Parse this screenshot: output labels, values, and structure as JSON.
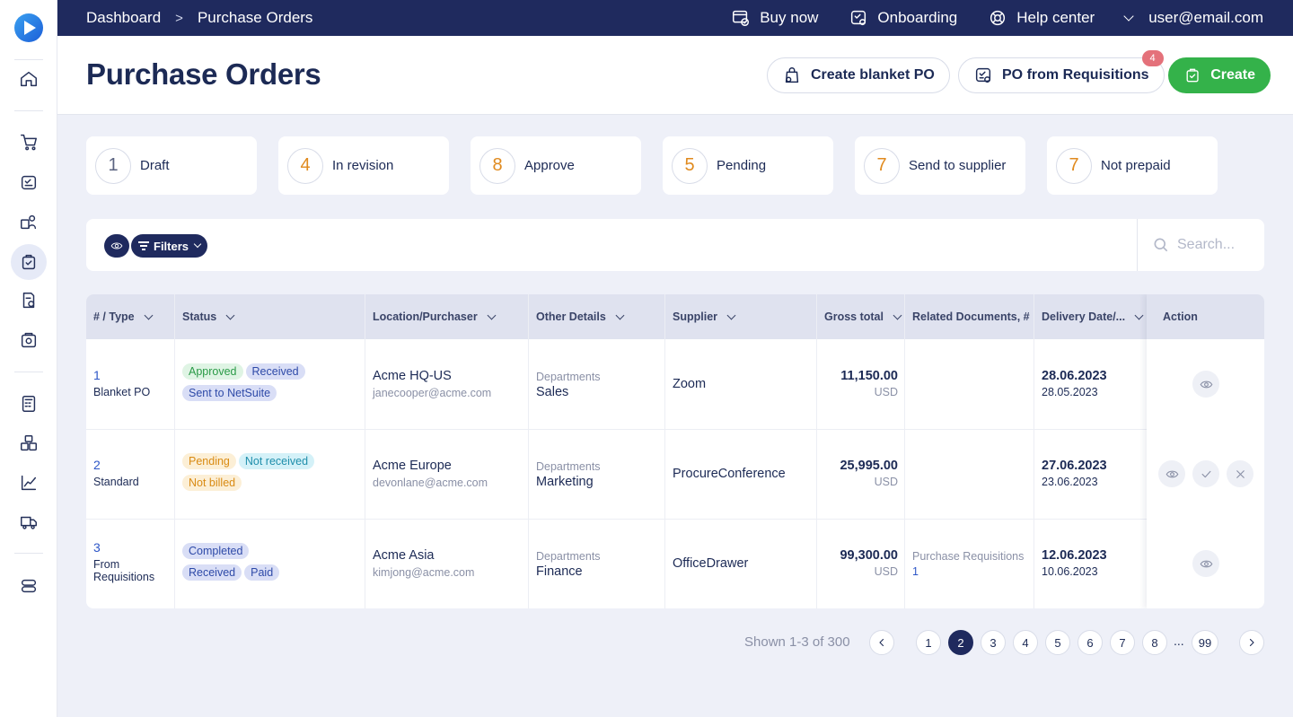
{
  "topbar": {
    "breadcrumb": [
      "Dashboard",
      "Purchase Orders"
    ],
    "links": [
      {
        "label": "Buy now",
        "icon": "cart-card-icon"
      },
      {
        "label": "Onboarding",
        "icon": "onboarding-icon"
      },
      {
        "label": "Help center",
        "icon": "lifebuoy-icon"
      }
    ],
    "user": "user@email.com"
  },
  "header": {
    "title": "Purchase Orders",
    "blanket_label": "Create blanket PO",
    "requisitions_label": "PO from Requisitions",
    "requisitions_badge": "4",
    "create_label": "Create"
  },
  "status_cards": [
    {
      "count": "1",
      "label": "Draft"
    },
    {
      "count": "4",
      "label": "In revision"
    },
    {
      "count": "8",
      "label": "Approve"
    },
    {
      "count": "5",
      "label": "Pending"
    },
    {
      "count": "7",
      "label": "Send to supplier"
    },
    {
      "count": "7",
      "label": "Not prepaid"
    }
  ],
  "filters": {
    "filters_label": "Filters",
    "search_placeholder": "Search..."
  },
  "table": {
    "columns": [
      "# / Type",
      "Status",
      "Location/Purchaser",
      "Other Details",
      "Supplier",
      "Gross total",
      "Related Documents, #",
      "Delivery Date/...",
      "Action"
    ],
    "rows": [
      {
        "num": "1",
        "type": "Blanket PO",
        "tags": [
          {
            "text": "Approved",
            "color": "green"
          },
          {
            "text": "Received",
            "color": "blue"
          },
          {
            "text": "Sent to NetSuite",
            "color": "blue"
          }
        ],
        "location": "Acme HQ-US",
        "purchaser": "janecooper@acme.com",
        "details_label": "Departments",
        "details_value": "Sales",
        "supplier": "Zoom",
        "gross": "11,150.00",
        "currency": "USD",
        "related_label": "",
        "related_value": "",
        "delivery": "28.06.2023",
        "delivery2": "28.05.2023"
      },
      {
        "num": "2",
        "type": "Standard",
        "tags": [
          {
            "text": "Pending",
            "color": "orange"
          },
          {
            "text": "Not received",
            "color": "teal"
          },
          {
            "text": "Not billed",
            "color": "orange"
          }
        ],
        "location": "Acme Europe",
        "purchaser": "devonlane@acme.com",
        "details_label": "Departments",
        "details_value": "Marketing",
        "supplier": "ProcureConference",
        "gross": "25,995.00",
        "currency": "USD",
        "related_label": "",
        "related_value": "",
        "delivery": "27.06.2023",
        "delivery2": "23.06.2023"
      },
      {
        "num": "3",
        "type": "From Requisitions",
        "tags": [
          {
            "text": "Completed",
            "color": "blue"
          },
          {
            "text": "Received",
            "color": "blue"
          },
          {
            "text": "Paid",
            "color": "blue"
          }
        ],
        "location": "Acme Asia",
        "purchaser": "kimjong@acme.com",
        "details_label": "Departments",
        "details_value": "Finance",
        "supplier": "OfficeDrawer",
        "gross": "99,300.00",
        "currency": "USD",
        "related_label": "Purchase Requisitions",
        "related_value": "1",
        "delivery": "12.06.2023",
        "delivery2": "10.06.2023"
      }
    ]
  },
  "pagination": {
    "shown_text": "Shown 1-3 of 300",
    "pages": [
      "1",
      "2",
      "3",
      "4",
      "5",
      "6",
      "7",
      "8"
    ],
    "ellipsis": "...",
    "last_page": "99",
    "current_page": "2"
  },
  "colors": {
    "navy": "#1f2a5e",
    "green": "#34b24a",
    "accent_orange": "#e08a1e",
    "link_blue": "#2d56c7"
  }
}
